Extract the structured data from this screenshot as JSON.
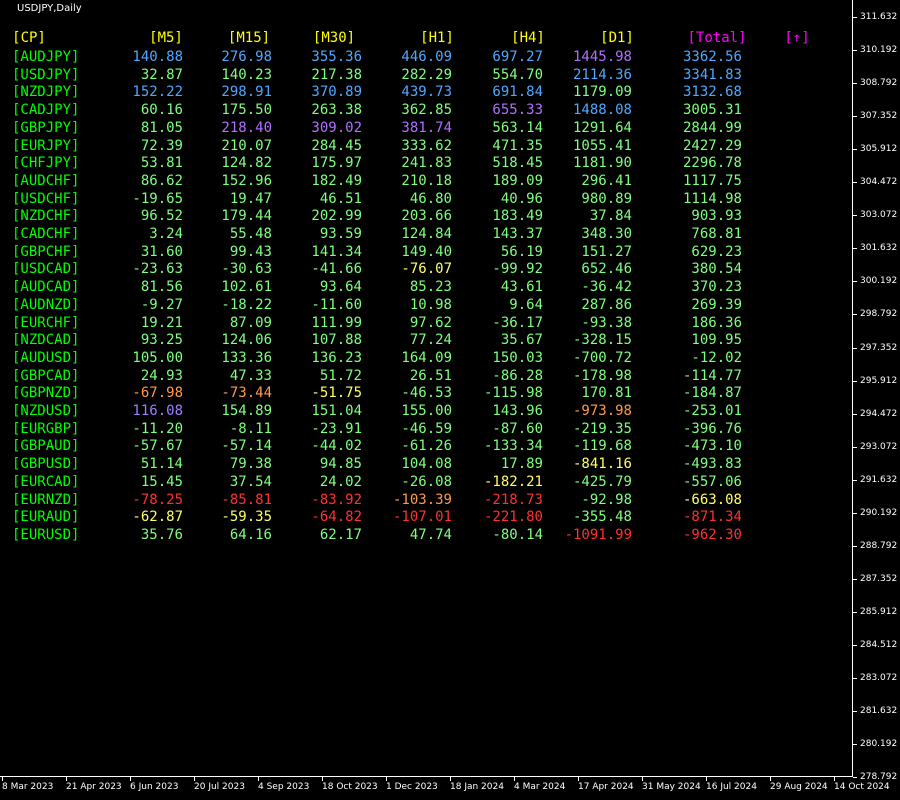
{
  "window": {
    "title": "USDJPY,Daily"
  },
  "axis": {
    "y_ticks": [
      "311.632",
      "310.192",
      "308.792",
      "307.352",
      "305.912",
      "304.472",
      "303.072",
      "301.632",
      "300.192",
      "298.792",
      "297.352",
      "295.912",
      "294.472",
      "293.072",
      "291.632",
      "290.192",
      "288.792",
      "287.352",
      "285.912",
      "284.512",
      "283.072",
      "281.632",
      "280.192",
      "278.792"
    ],
    "x_ticks": [
      "8 Mar 2023",
      "21 Apr 2023",
      "6 Jun 2023",
      "20 Jul 2023",
      "4 Sep 2023",
      "18 Oct 2023",
      "1 Dec 2023",
      "18 Jan 2024",
      "4 Mar 2024",
      "17 Apr 2024",
      "31 May 2024",
      "16 Jul 2024",
      "29 Aug 2024",
      "14 Oct 2024"
    ]
  },
  "colors": {
    "green": "#00ff00",
    "lightgreen": "#7fff7f",
    "yellow": "#ffff00",
    "gold": "#ffd700",
    "cyan": "#00bfff",
    "lightblue": "#7fbfff",
    "violet": "#9370db",
    "magenta": "#ff00ff",
    "orange": "#ff8c40",
    "red": "#ff2020",
    "purple": "#b070ff"
  },
  "table": {
    "headers": [
      {
        "label": "[CP]",
        "color": "#ffff00"
      },
      {
        "label": "[M5]",
        "color": "#ffff00"
      },
      {
        "label": "[M15]",
        "color": "#ffff00"
      },
      {
        "label": "[M30]",
        "color": "#ffff00"
      },
      {
        "label": "[H1]",
        "color": "#ffff00"
      },
      {
        "label": "[H4]",
        "color": "#ffff00"
      },
      {
        "label": "[D1]",
        "color": "#ffff00"
      },
      {
        "label": "[Total]",
        "color": "#ff00ff"
      },
      {
        "label": "[↑]",
        "color": "#ff00ff"
      }
    ],
    "rows": [
      {
        "pair": "[AUDJPY]",
        "v": [
          "140.88",
          "276.98",
          "355.36",
          "446.09",
          "697.27",
          "1445.98",
          "3362.56"
        ],
        "c": [
          "#4fa8ff",
          "#4fa8ff",
          "#4fa8ff",
          "#4fa8ff",
          "#4fa8ff",
          "#b070ff",
          "#4fa8ff"
        ]
      },
      {
        "pair": "[USDJPY]",
        "v": [
          "32.87",
          "140.23",
          "217.38",
          "282.29",
          "554.70",
          "2114.36",
          "3341.83"
        ],
        "c": [
          "#7fff7f",
          "#7fff7f",
          "#7fff7f",
          "#7fff7f",
          "#7fff7f",
          "#4fa8ff",
          "#4fa8ff"
        ]
      },
      {
        "pair": "[NZDJPY]",
        "v": [
          "152.22",
          "298.91",
          "370.89",
          "439.73",
          "691.84",
          "1179.09",
          "3132.68"
        ],
        "c": [
          "#4fa8ff",
          "#4fa8ff",
          "#4fa8ff",
          "#4fa8ff",
          "#4fa8ff",
          "#7fff7f",
          "#4fa8ff"
        ]
      },
      {
        "pair": "[CADJPY]",
        "v": [
          "60.16",
          "175.50",
          "263.38",
          "362.85",
          "655.33",
          "1488.08",
          "3005.31"
        ],
        "c": [
          "#7fff7f",
          "#7fff7f",
          "#7fff7f",
          "#7fff7f",
          "#b070ff",
          "#4fa8ff",
          "#7fff7f"
        ]
      },
      {
        "pair": "[GBPJPY]",
        "v": [
          "81.05",
          "218.40",
          "309.02",
          "381.74",
          "563.14",
          "1291.64",
          "2844.99"
        ],
        "c": [
          "#7fff7f",
          "#b070ff",
          "#b070ff",
          "#b070ff",
          "#7fff7f",
          "#7fff7f",
          "#7fff7f"
        ]
      },
      {
        "pair": "[EURJPY]",
        "v": [
          "72.39",
          "210.07",
          "284.45",
          "333.62",
          "471.35",
          "1055.41",
          "2427.29"
        ],
        "c": [
          "#7fff7f",
          "#7fff7f",
          "#7fff7f",
          "#7fff7f",
          "#7fff7f",
          "#7fff7f",
          "#7fff7f"
        ]
      },
      {
        "pair": "[CHFJPY]",
        "v": [
          "53.81",
          "124.82",
          "175.97",
          "241.83",
          "518.45",
          "1181.90",
          "2296.78"
        ],
        "c": [
          "#7fff7f",
          "#7fff7f",
          "#7fff7f",
          "#7fff7f",
          "#7fff7f",
          "#7fff7f",
          "#7fff7f"
        ]
      },
      {
        "pair": "[AUDCHF]",
        "v": [
          "86.62",
          "152.96",
          "182.49",
          "210.18",
          "189.09",
          "296.41",
          "1117.75"
        ],
        "c": [
          "#7fff7f",
          "#7fff7f",
          "#7fff7f",
          "#7fff7f",
          "#7fff7f",
          "#7fff7f",
          "#7fff7f"
        ]
      },
      {
        "pair": "[USDCHF]",
        "v": [
          "-19.65",
          "19.47",
          "46.51",
          "46.80",
          "40.96",
          "980.89",
          "1114.98"
        ],
        "c": [
          "#7fff7f",
          "#7fff7f",
          "#7fff7f",
          "#7fff7f",
          "#7fff7f",
          "#7fff7f",
          "#7fff7f"
        ]
      },
      {
        "pair": "[NZDCHF]",
        "v": [
          "96.52",
          "179.44",
          "202.99",
          "203.66",
          "183.49",
          "37.84",
          "903.93"
        ],
        "c": [
          "#7fff7f",
          "#7fff7f",
          "#7fff7f",
          "#7fff7f",
          "#7fff7f",
          "#7fff7f",
          "#7fff7f"
        ]
      },
      {
        "pair": "[CADCHF]",
        "v": [
          "3.24",
          "55.48",
          "93.59",
          "124.84",
          "143.37",
          "348.30",
          "768.81"
        ],
        "c": [
          "#7fff7f",
          "#7fff7f",
          "#7fff7f",
          "#7fff7f",
          "#7fff7f",
          "#7fff7f",
          "#7fff7f"
        ]
      },
      {
        "pair": "[GBPCHF]",
        "v": [
          "31.60",
          "99.43",
          "141.34",
          "149.40",
          "56.19",
          "151.27",
          "629.23"
        ],
        "c": [
          "#7fff7f",
          "#7fff7f",
          "#7fff7f",
          "#7fff7f",
          "#7fff7f",
          "#7fff7f",
          "#7fff7f"
        ]
      },
      {
        "pair": "[USDCAD]",
        "v": [
          "-23.63",
          "-30.63",
          "-41.66",
          "-76.07",
          "-99.92",
          "652.46",
          "380.54"
        ],
        "c": [
          "#7fff7f",
          "#7fff7f",
          "#7fff7f",
          "#ffff66",
          "#7fff7f",
          "#7fff7f",
          "#7fff7f"
        ]
      },
      {
        "pair": "[AUDCAD]",
        "v": [
          "81.56",
          "102.61",
          "93.64",
          "85.23",
          "43.61",
          "-36.42",
          "370.23"
        ],
        "c": [
          "#7fff7f",
          "#7fff7f",
          "#7fff7f",
          "#7fff7f",
          "#7fff7f",
          "#7fff7f",
          "#7fff7f"
        ]
      },
      {
        "pair": "[AUDNZD]",
        "v": [
          "-9.27",
          "-18.22",
          "-11.60",
          "10.98",
          "9.64",
          "287.86",
          "269.39"
        ],
        "c": [
          "#7fff7f",
          "#7fff7f",
          "#7fff7f",
          "#7fff7f",
          "#7fff7f",
          "#7fff7f",
          "#7fff7f"
        ]
      },
      {
        "pair": "[EURCHF]",
        "v": [
          "19.21",
          "87.09",
          "111.99",
          "97.62",
          "-36.17",
          "-93.38",
          "186.36"
        ],
        "c": [
          "#7fff7f",
          "#7fff7f",
          "#7fff7f",
          "#7fff7f",
          "#7fff7f",
          "#7fff7f",
          "#7fff7f"
        ]
      },
      {
        "pair": "[NZDCAD]",
        "v": [
          "93.25",
          "124.06",
          "107.88",
          "77.24",
          "35.67",
          "-328.15",
          "109.95"
        ],
        "c": [
          "#7fff7f",
          "#7fff7f",
          "#7fff7f",
          "#7fff7f",
          "#7fff7f",
          "#7fff7f",
          "#7fff7f"
        ]
      },
      {
        "pair": "[AUDUSD]",
        "v": [
          "105.00",
          "133.36",
          "136.23",
          "164.09",
          "150.03",
          "-700.72",
          "-12.02"
        ],
        "c": [
          "#7fff7f",
          "#7fff7f",
          "#7fff7f",
          "#7fff7f",
          "#7fff7f",
          "#7fff7f",
          "#7fff7f"
        ]
      },
      {
        "pair": "[GBPCAD]",
        "v": [
          "24.93",
          "47.33",
          "51.72",
          "26.51",
          "-86.28",
          "-178.98",
          "-114.77"
        ],
        "c": [
          "#7fff7f",
          "#7fff7f",
          "#7fff7f",
          "#7fff7f",
          "#7fff7f",
          "#7fff7f",
          "#7fff7f"
        ]
      },
      {
        "pair": "[GBPNZD]",
        "v": [
          "-67.98",
          "-73.44",
          "-51.75",
          "-46.53",
          "-115.98",
          "170.81",
          "-184.87"
        ],
        "c": [
          "#ff9a4a",
          "#ff9a4a",
          "#ffff66",
          "#7fff7f",
          "#7fff7f",
          "#7fff7f",
          "#7fff7f"
        ]
      },
      {
        "pair": "[NZDUSD]",
        "v": [
          "116.08",
          "154.89",
          "151.04",
          "155.00",
          "143.96",
          "-973.98",
          "-253.01"
        ],
        "c": [
          "#9f7fff",
          "#7fff7f",
          "#7fff7f",
          "#7fff7f",
          "#7fff7f",
          "#ff9a4a",
          "#7fff7f"
        ]
      },
      {
        "pair": "[EURGBP]",
        "v": [
          "-11.20",
          "-8.11",
          "-23.91",
          "-46.59",
          "-87.60",
          "-219.35",
          "-396.76"
        ],
        "c": [
          "#7fff7f",
          "#7fff7f",
          "#7fff7f",
          "#7fff7f",
          "#7fff7f",
          "#7fff7f",
          "#7fff7f"
        ]
      },
      {
        "pair": "[GBPAUD]",
        "v": [
          "-57.67",
          "-57.14",
          "-44.02",
          "-61.26",
          "-133.34",
          "-119.68",
          "-473.10"
        ],
        "c": [
          "#7fff7f",
          "#7fff7f",
          "#7fff7f",
          "#7fff7f",
          "#7fff7f",
          "#7fff7f",
          "#7fff7f"
        ]
      },
      {
        "pair": "[GBPUSD]",
        "v": [
          "51.14",
          "79.38",
          "94.85",
          "104.08",
          "17.89",
          "-841.16",
          "-493.83"
        ],
        "c": [
          "#7fff7f",
          "#7fff7f",
          "#7fff7f",
          "#7fff7f",
          "#7fff7f",
          "#ffff66",
          "#7fff7f"
        ]
      },
      {
        "pair": "[EURCAD]",
        "v": [
          "15.45",
          "37.54",
          "24.02",
          "-26.08",
          "-182.21",
          "-425.79",
          "-557.06"
        ],
        "c": [
          "#7fff7f",
          "#7fff7f",
          "#7fff7f",
          "#7fff7f",
          "#ffff66",
          "#7fff7f",
          "#7fff7f"
        ]
      },
      {
        "pair": "[EURNZD]",
        "v": [
          "-78.25",
          "-85.81",
          "-83.92",
          "-103.39",
          "-218.73",
          "-92.98",
          "-663.08"
        ],
        "c": [
          "#ff3030",
          "#ff3030",
          "#ff3030",
          "#ff9a4a",
          "#ff3030",
          "#7fff7f",
          "#ffff66"
        ]
      },
      {
        "pair": "[EURAUD]",
        "v": [
          "-62.87",
          "-59.35",
          "-64.82",
          "-107.01",
          "-221.80",
          "-355.48",
          "-871.34"
        ],
        "c": [
          "#ffff66",
          "#ffff66",
          "#ff3030",
          "#ff3030",
          "#ff3030",
          "#7fff7f",
          "#ff3030"
        ]
      },
      {
        "pair": "[EURUSD]",
        "v": [
          "35.76",
          "64.16",
          "62.17",
          "47.74",
          "-80.14",
          "-1091.99",
          "-962.30"
        ],
        "c": [
          "#7fff7f",
          "#7fff7f",
          "#7fff7f",
          "#7fff7f",
          "#7fff7f",
          "#ff3030",
          "#ff3030"
        ]
      }
    ],
    "pair_color": "#00ff00"
  }
}
